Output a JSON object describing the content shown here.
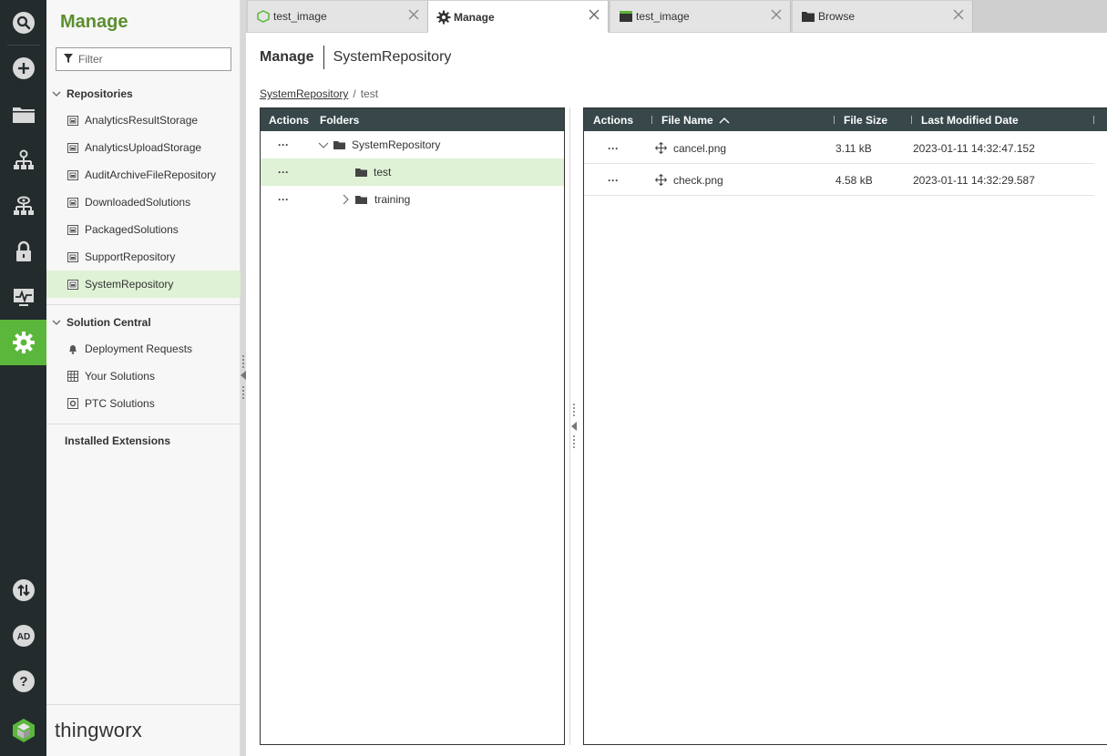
{
  "colors": {
    "accent": "#5bb73b",
    "rail_bg": "#232b2d",
    "header_bg": "#37474a",
    "selected_bg": "#dff2d6",
    "title_green": "#5a8f2e"
  },
  "rail": {
    "icons": [
      "search-icon",
      "add-icon",
      "folder-icon",
      "model-icon",
      "view-icon",
      "lock-icon",
      "monitor-icon",
      "gear-icon"
    ],
    "bottom_icons": [
      "import-export-icon",
      "avatar",
      "help-icon"
    ],
    "avatar_initials": "AD"
  },
  "nav": {
    "title": "Manage",
    "filter_placeholder": "Filter",
    "sections": {
      "repositories": "Repositories",
      "solution_central": "Solution Central",
      "installed_extensions": "Installed Extensions"
    },
    "repositories": [
      "AnalyticsResultStorage",
      "AnalyticsUploadStorage",
      "AuditArchiveFileRepository",
      "DownloadedSolutions",
      "PackagedSolutions",
      "SupportRepository",
      "SystemRepository"
    ],
    "solution_items": [
      "Deployment Requests",
      "Your Solutions",
      "PTC Solutions"
    ],
    "brand": "thingworx"
  },
  "tabs": [
    {
      "label": "test_image",
      "icon": "thing-hex-icon"
    },
    {
      "label": "Manage",
      "icon": "gear-icon"
    },
    {
      "label": "test_image",
      "icon": "mashup-icon"
    },
    {
      "label": "Browse",
      "icon": "folder-icon"
    }
  ],
  "main": {
    "heading": "Manage",
    "subheading": "SystemRepository",
    "path_root": "SystemRepository",
    "path_current": "test"
  },
  "folders_panel": {
    "headers": {
      "actions": "Actions",
      "folders": "Folders"
    },
    "rows": [
      {
        "name": "SystemRepository",
        "actions": "···"
      },
      {
        "name": "test",
        "actions": "···"
      },
      {
        "name": "training",
        "actions": "···"
      }
    ]
  },
  "files_panel": {
    "headers": {
      "actions": "Actions",
      "file_name": "File Name",
      "file_size": "File Size",
      "modified": "Last Modified Date"
    },
    "rows": [
      {
        "actions": "···",
        "name": "cancel.png",
        "size": "3.11 kB",
        "modified": "2023-01-11 14:32:47.152"
      },
      {
        "actions": "···",
        "name": "check.png",
        "size": "4.58 kB",
        "modified": "2023-01-11 14:32:29.587"
      }
    ]
  }
}
